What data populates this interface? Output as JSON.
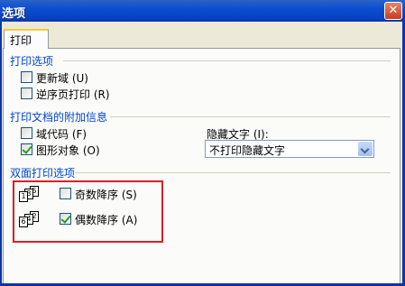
{
  "window": {
    "title": "选项",
    "close_glyph": "✕"
  },
  "tabs": [
    {
      "label": "打印"
    }
  ],
  "print_options": {
    "title": "打印选项",
    "items": [
      {
        "label": "更新域 (U)",
        "checked": false
      },
      {
        "label": "逆序页打印 (R)",
        "checked": false
      }
    ]
  },
  "attach_info": {
    "title": "打印文档的附加信息",
    "items": [
      {
        "label": "域代码 (F)",
        "checked": false
      },
      {
        "label": "图形对象 (O)",
        "checked": true
      }
    ],
    "hidden_text": {
      "label": "隐藏文字 (I):",
      "value": "不打印隐藏文字"
    }
  },
  "duplex": {
    "title": "双面打印选项",
    "items": [
      {
        "label": "奇数降序 (S)",
        "checked": false,
        "icon": "odd-pages-icon",
        "front": "1",
        "mid": "3",
        "back": "5"
      },
      {
        "label": "偶数降序 (A)",
        "checked": true,
        "icon": "even-pages-icon",
        "front": "6",
        "mid": "4",
        "back": "2"
      }
    ]
  },
  "colors": {
    "titlebar": "#0A4FD0",
    "group_title": "#0046D5",
    "highlight": "#D8202A"
  }
}
